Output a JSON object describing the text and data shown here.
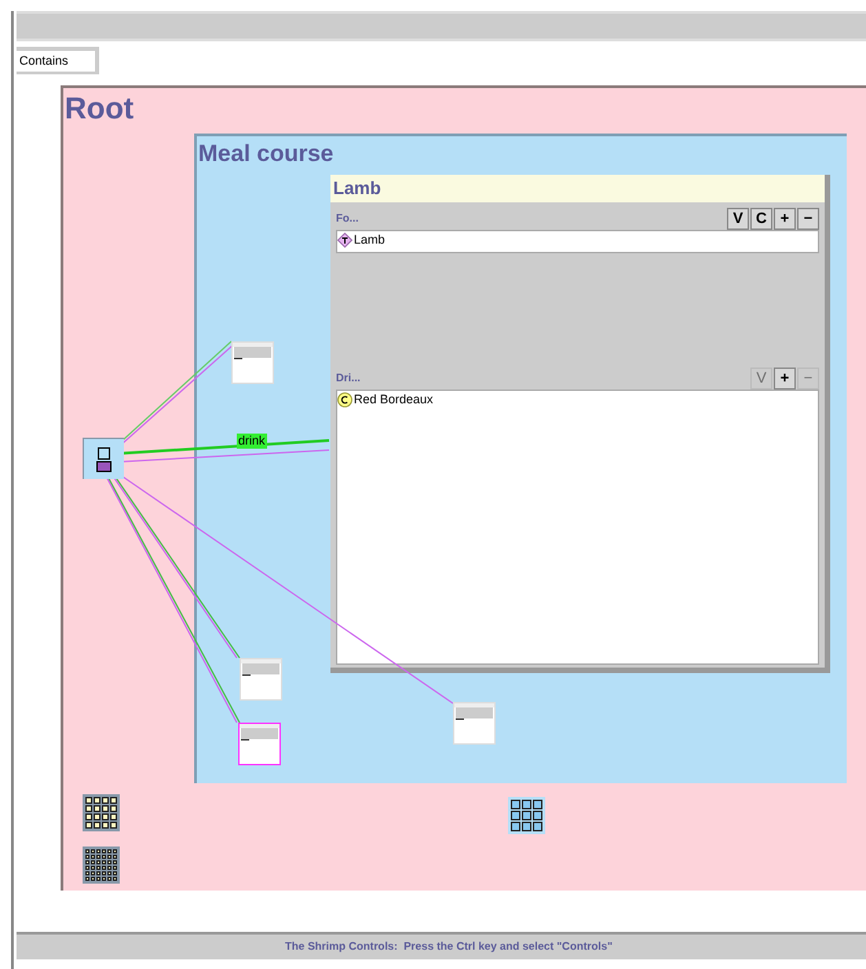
{
  "filter": {
    "value": "Contains"
  },
  "root": {
    "title": "Root"
  },
  "meal_course": {
    "title": "Meal course"
  },
  "lamb_window": {
    "title": "Lamb",
    "sections": [
      {
        "label": "Fo...",
        "buttons": [
          {
            "label": "V",
            "disabled": false
          },
          {
            "label": "C",
            "disabled": false
          },
          {
            "label": "+",
            "disabled": false
          },
          {
            "label": "−",
            "disabled": false
          }
        ],
        "items": [
          {
            "label": "Lamb",
            "kind": "instance"
          }
        ]
      },
      {
        "label": "Dri...",
        "buttons": [
          {
            "label": "V",
            "disabled": true
          },
          {
            "label": "+",
            "disabled": false
          },
          {
            "label": "−",
            "disabled": true
          }
        ],
        "items": [
          {
            "label": "Red Bordeaux",
            "kind": "class"
          }
        ]
      }
    ]
  },
  "edges": [
    {
      "color": "#66cc66"
    },
    {
      "color": "#cc66ee"
    },
    {
      "color": "#22cc22",
      "label": "drink"
    },
    {
      "color": "#cc66ee"
    },
    {
      "color": "#cc66ee"
    },
    {
      "color": "#44bb44"
    },
    {
      "color": "#cc66ee"
    },
    {
      "color": "#44bb44"
    },
    {
      "color": "#cc66ee"
    }
  ],
  "thumbnails": [
    {
      "selected": false
    },
    {
      "selected": false
    },
    {
      "selected": true
    },
    {
      "selected": false
    }
  ],
  "status_bar": {
    "text": "The Shrimp Controls:  Press the Ctrl key and select \"Controls\""
  }
}
